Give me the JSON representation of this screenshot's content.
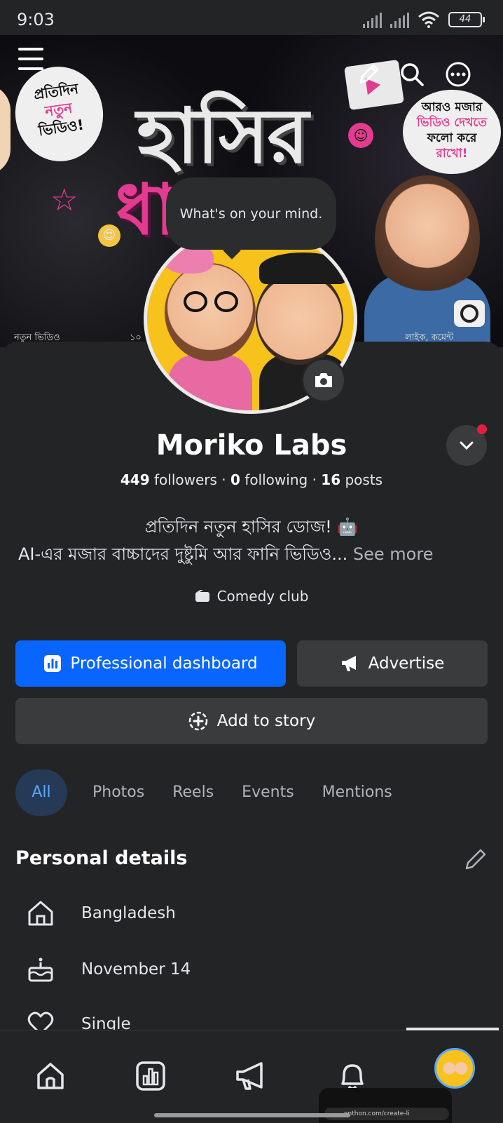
{
  "status_bar": {
    "time": "9:03",
    "battery": "44"
  },
  "cover": {
    "title_line1": "হাসির",
    "title_line2": "ধামাকা",
    "bubble_left": [
      "প্রতিদিন",
      "নতুন",
      "ভিডিও!"
    ],
    "bubble_right": [
      "আরও মজার",
      "ভিডিও দেখতে",
      "ফলো করে",
      "রাখো!"
    ],
    "strip_left": "নতুন ভিডিও",
    "strip_mid": "১০",
    "strip_right": "লাইক, কমেন্ট"
  },
  "mind_prompt": "What's on your mind.",
  "profile": {
    "name": "Moriko Labs",
    "followers_count": "449",
    "followers_label": "followers",
    "following_count": "0",
    "following_label": "following",
    "posts_count": "16",
    "posts_label": "posts",
    "separator": "·",
    "bio_line1": "প্রতিদিন নতুন হাসির ডোজ! 🤖",
    "bio_line2": "AI-এর মজার বাচ্চাদের দুষ্টুমি আর ফানি ভিডিও...",
    "see_more": "See more",
    "category": "Comedy club"
  },
  "actions": {
    "dashboard": "Professional dashboard",
    "advertise": "Advertise",
    "add_story": "Add to story"
  },
  "tabs": [
    "All",
    "Photos",
    "Reels",
    "Events",
    "Mentions"
  ],
  "personal_details": {
    "title": "Personal details",
    "items": [
      {
        "icon": "home-icon",
        "text": "Bangladesh"
      },
      {
        "icon": "cake-icon",
        "text": "November 14"
      },
      {
        "icon": "heart-icon",
        "text": "Single"
      }
    ]
  },
  "bottom_nav": [
    "home-icon",
    "dashboard-icon",
    "megaphone-icon",
    "bell-icon",
    "profile-avatar"
  ],
  "mini_window_url": "onthon.com/create-li"
}
